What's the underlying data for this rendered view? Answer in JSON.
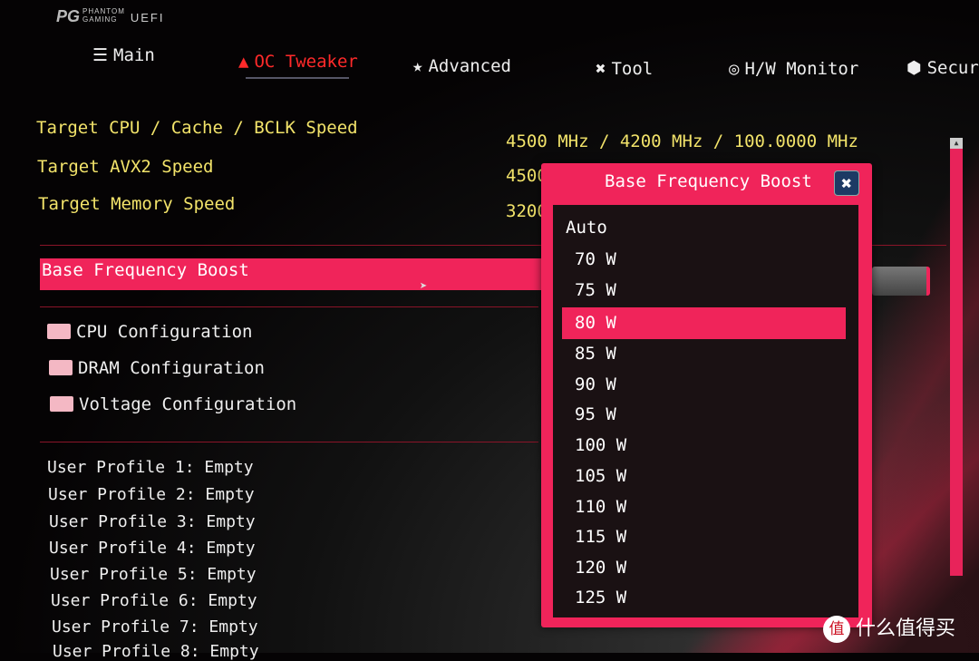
{
  "logo": {
    "brand_line1": "PHANTOM",
    "brand_line2": "GAMING",
    "suffix": "UEFI"
  },
  "nav": [
    {
      "label": "Main",
      "icon": "list-icon"
    },
    {
      "label": "OC Tweaker",
      "icon": "rocket-icon",
      "active": true
    },
    {
      "label": "Advanced",
      "icon": "star-icon"
    },
    {
      "label": "Tool",
      "icon": "tools-icon"
    },
    {
      "label": "H/W Monitor",
      "icon": "monitor-icon"
    },
    {
      "label": "Secur",
      "icon": "shield-icon"
    }
  ],
  "targets": [
    {
      "label": "Target CPU / Cache / BCLK Speed",
      "value": "4500 MHz / 4200 MHz / 100.0000 MHz"
    },
    {
      "label": "Target AVX2 Speed",
      "value": "4500 MHz"
    },
    {
      "label": "Target Memory Speed",
      "value": "3200"
    }
  ],
  "selected_item": "Base Frequency Boost",
  "folders": [
    "CPU Configuration",
    "DRAM Configuration",
    "Voltage Configuration"
  ],
  "profiles": [
    "User Profile 1: Empty",
    "User Profile 2: Empty",
    "User Profile 3: Empty",
    "User Profile 4: Empty",
    "User Profile 5: Empty",
    "User Profile 6: Empty",
    "User Profile 7: Empty",
    "User Profile 8: Empty"
  ],
  "popup": {
    "title": "Base Frequency Boost",
    "close": "✖",
    "options": [
      "Auto",
      "70 W",
      "75 W",
      "80 W",
      "85 W",
      "90 W",
      "95 W",
      "100 W",
      "105 W",
      "110 W",
      "115 W",
      "120 W",
      "125 W"
    ],
    "highlighted": "80 W"
  },
  "watermark": {
    "badge": "值",
    "text": "什么值得买"
  },
  "colors": {
    "accent": "#f0245a",
    "yellow": "#f2e36a",
    "active_tab": "#ff2a2a"
  }
}
